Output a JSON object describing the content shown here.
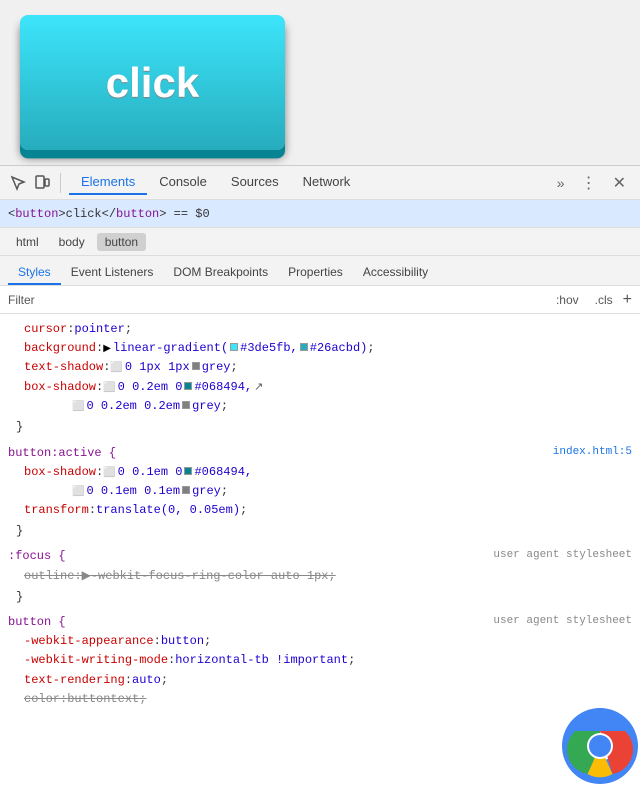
{
  "preview": {
    "button_label": "click"
  },
  "devtools": {
    "toolbar": {
      "inspect_icon": "⊡",
      "device_icon": "⬜",
      "tabs": [
        {
          "label": "Elements",
          "active": true
        },
        {
          "label": "Console",
          "active": false
        },
        {
          "label": "Sources",
          "active": false
        },
        {
          "label": "Network",
          "active": false
        }
      ],
      "more_label": "»",
      "kebab_label": "⋮",
      "close_label": "✕"
    },
    "element_row": {
      "text": "<button>click</button>  == $0"
    },
    "html_breadcrumb": {
      "items": [
        "html",
        "body",
        "button"
      ]
    },
    "sub_tabs": [
      {
        "label": "Styles",
        "active": true
      },
      {
        "label": "Event Listeners",
        "active": false
      },
      {
        "label": "DOM Breakpoints",
        "active": false
      },
      {
        "label": "Properties",
        "active": false
      },
      {
        "label": "Accessibility",
        "active": false
      }
    ],
    "filter": {
      "placeholder": "Filter",
      "hov_label": ":hov",
      "cls_label": ".cls",
      "plus_label": "+"
    }
  },
  "styles": {
    "blocks": [
      {
        "id": "main-rule",
        "selector": "",
        "source": "",
        "properties": [
          {
            "name": "cursor",
            "value": "pointer",
            "strikethrough": false,
            "has_color": false
          },
          {
            "name": "background",
            "value": "linear-gradient(#3de5fb, #26acbd)",
            "strikethrough": false,
            "has_gradient": true,
            "gradient_color1": "#3de5fb",
            "gradient_color2": "#26acbd"
          },
          {
            "name": "text-shadow",
            "value": "0 1px 1px",
            "color": "grey",
            "strikethrough": false,
            "has_color": true,
            "color_swatch": "#808080"
          },
          {
            "name": "box-shadow",
            "value": "0 0.2em 0",
            "color": "#068494",
            "extra": "0 0.2em 0.2em",
            "extra_color": "grey",
            "strikethrough": false,
            "has_color": true
          }
        ]
      },
      {
        "id": "button-active",
        "selector": "button:active {",
        "source": "index.html:5",
        "properties": [
          {
            "name": "box-shadow",
            "value": "0 0.1em 0",
            "color": "#068494",
            "extra": "0 0.1em 0.1em",
            "extra_color": "grey",
            "strikethrough": false,
            "has_color": true
          },
          {
            "name": "transform",
            "value": "translate(0, 0.05em)",
            "strikethrough": false,
            "has_color": false
          }
        ]
      },
      {
        "id": "focus-rule",
        "selector": ":focus {",
        "source": "user agent stylesheet",
        "properties": [
          {
            "name": "outline",
            "value": "-webkit-focus-ring-color auto 1px",
            "strikethrough": true,
            "has_color": false
          }
        ]
      },
      {
        "id": "button-rule",
        "selector": "button {",
        "source": "user agent stylesheet",
        "properties": [
          {
            "name": "-webkit-appearance",
            "value": "button",
            "strikethrough": false,
            "has_color": false
          },
          {
            "name": "-webkit-writing-mode",
            "value": "horizontal-tb !important",
            "strikethrough": false,
            "has_color": false
          },
          {
            "name": "text-rendering",
            "value": "auto",
            "strikethrough": false,
            "has_color": false
          },
          {
            "name": "color",
            "value": "buttontext",
            "strikethrough": false,
            "has_color": false
          }
        ]
      }
    ]
  },
  "chrome_icon": {
    "visible": true
  }
}
